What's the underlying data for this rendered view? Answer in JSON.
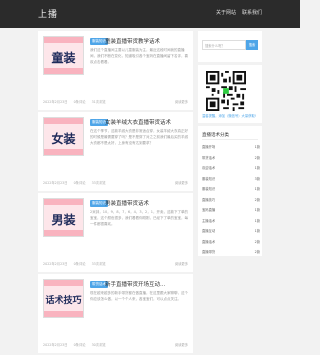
{
  "header": {
    "logo": "上播",
    "nav": [
      "关于网站",
      "联系我们"
    ]
  },
  "posts": [
    {
      "thumb_word": "童装",
      "category": "服装知识",
      "title": "童装直播带货教学话术",
      "excerpt": "我们这个直播间主要以儿童服装为主，最近这段时间我的直播间，我们不断在变化，知道吸引各个宝妈在直播间留下名评，喜欢点击看看。",
      "date": "2022年2月23日",
      "views": "0条评论",
      "reads": "31次浏览",
      "more": "阅读更多"
    },
    {
      "thumb_word": "女装",
      "category": "服装知识",
      "title": "女装羊绒大衣直播带货话术",
      "excerpt": "在这个季节，这款羊绒大衣是非常适合穿，女装羊绒大衣真正好的时候是最需要穿了吗？是不是穿了对之之前我们最后买的羊绒大衣都不是太好，上身有没有达到要求？",
      "date": "2022年2月23日",
      "views": "0条评论",
      "reads": "33次浏览",
      "more": "阅读更多"
    },
    {
      "thumb_word": "男装",
      "category": "服装知识",
      "title": "男装直播带货话术",
      "excerpt": "2米钟，10，9，8，7，6，4，3，2，1，开卖，这款下了单的宝宝，这个颜色很多，我们看看你刚刚，已经下了单的宝宝，每一件都很喜欢。",
      "date": "2022年2月23日",
      "views": "0条评论",
      "reads": "33次浏览",
      "more": "阅读更多"
    },
    {
      "thumb_word": "话术技巧",
      "category": "带货话术",
      "title": "新手直播带货开场互动...",
      "excerpt": "现在越来越多的新手带货都在做直播，在这里跟大家聊聊，这个你应该怎么做，以一个个人来，各宝宝们，可以点点关注。",
      "date": "2022年2月23日",
      "views": "0条评论",
      "reads": "30次浏览",
      "more": "阅读更多"
    }
  ],
  "sidebar": {
    "search": {
      "placeholder": "搜索什么呢？",
      "button": "搜索"
    },
    "qr_caption": "温馨提醒，添加（微信号）大量获取!",
    "tags_title": "直播话术分类",
    "tags": [
      {
        "name": "直播开场",
        "count": "1篇"
      },
      {
        "name": "带货话术",
        "count": "2篇"
      },
      {
        "name": "欢迎话术",
        "count": "1篇"
      },
      {
        "name": "服装知识",
        "count": "3篇"
      },
      {
        "name": "服装知识",
        "count": "1篇"
      },
      {
        "name": "直播技巧",
        "count": "2篇"
      },
      {
        "name": "宝妈直播",
        "count": "1篇"
      },
      {
        "name": "主播话术",
        "count": "1篇"
      },
      {
        "name": "直播互动",
        "count": "1篇"
      },
      {
        "name": "直播话术",
        "count": "2篇"
      },
      {
        "name": "直播带货",
        "count": "2篇"
      }
    ]
  },
  "colors": {
    "accent": "#4ea5e8",
    "header_bg": "#2b2b2b",
    "thumb_bg": "#fde6ea"
  }
}
